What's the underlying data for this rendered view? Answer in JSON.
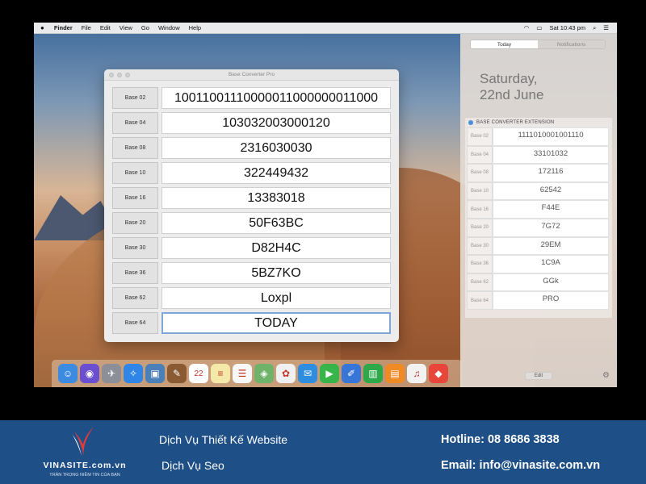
{
  "menubar": {
    "apple": "",
    "items": [
      "Finder",
      "File",
      "Edit",
      "View",
      "Go",
      "Window",
      "Help"
    ],
    "clock": "Sat 10:43 pm"
  },
  "app": {
    "title": "Base Converter Pro",
    "rows": [
      {
        "label": "Base 02",
        "value": "10011001110000011000000011000"
      },
      {
        "label": "Base 04",
        "value": "103032003000120"
      },
      {
        "label": "Base 08",
        "value": "2316030030"
      },
      {
        "label": "Base 10",
        "value": "322449432"
      },
      {
        "label": "Base 16",
        "value": "13383018"
      },
      {
        "label": "Base 20",
        "value": "50F63BC"
      },
      {
        "label": "Base 30",
        "value": "D82H4C"
      },
      {
        "label": "Base 36",
        "value": "5BZ7KO"
      },
      {
        "label": "Base 62",
        "value": "Loxpl"
      },
      {
        "label": "Base 64",
        "value": "TODAY"
      }
    ]
  },
  "notification_center": {
    "tabs": [
      "Today",
      "Notifications"
    ],
    "date_line1": "Saturday,",
    "date_line2": "22nd June",
    "extension_title": "BASE CONVERTER EXTENSION",
    "rows": [
      {
        "label": "Base 02",
        "value": "1111010001001110"
      },
      {
        "label": "Base 04",
        "value": "33101032"
      },
      {
        "label": "Base 08",
        "value": "172116"
      },
      {
        "label": "Base 10",
        "value": "62542"
      },
      {
        "label": "Base 16",
        "value": "F44E"
      },
      {
        "label": "Base 20",
        "value": "7G72"
      },
      {
        "label": "Base 30",
        "value": "29EM"
      },
      {
        "label": "Base 36",
        "value": "1C9A"
      },
      {
        "label": "Base 62",
        "value": "GGk"
      },
      {
        "label": "Base 64",
        "value": "PRO"
      }
    ],
    "edit_label": "Edit"
  },
  "dock": {
    "icons": [
      {
        "name": "finder-icon",
        "color": "#3d8be0",
        "glyph": "☺"
      },
      {
        "name": "siri-icon",
        "color": "#6a4fd1",
        "glyph": "◉"
      },
      {
        "name": "launchpad-icon",
        "color": "#8c8f98",
        "glyph": "✈"
      },
      {
        "name": "safari-icon",
        "color": "#2f86e6",
        "glyph": "✧"
      },
      {
        "name": "photo-browser-icon",
        "color": "#4a7fb8",
        "glyph": "▣"
      },
      {
        "name": "notes-brown-icon",
        "color": "#8a5a33",
        "glyph": "✎"
      },
      {
        "name": "calendar-icon",
        "color": "#ffffff",
        "glyph": "22"
      },
      {
        "name": "notes-icon",
        "color": "#f4e9a8",
        "glyph": "≡"
      },
      {
        "name": "reminders-icon",
        "color": "#f7f7f7",
        "glyph": "☰"
      },
      {
        "name": "maps-icon",
        "color": "#6fb36a",
        "glyph": "◈"
      },
      {
        "name": "photos-icon",
        "color": "#f0f0f0",
        "glyph": "✿"
      },
      {
        "name": "messages-icon",
        "color": "#2f8de0",
        "glyph": "✉"
      },
      {
        "name": "facetime-icon",
        "color": "#38b54a",
        "glyph": "▶"
      },
      {
        "name": "keynote-icon",
        "color": "#3776d6",
        "glyph": "✐"
      },
      {
        "name": "numbers-icon",
        "color": "#2fa84a",
        "glyph": "▥"
      },
      {
        "name": "pages-icon",
        "color": "#f08a24",
        "glyph": "▤"
      },
      {
        "name": "music-icon",
        "color": "#f2f2f2",
        "glyph": "♫"
      },
      {
        "name": "app-store-icon",
        "color": "#e8463b",
        "glyph": "◆"
      }
    ]
  },
  "footer": {
    "brand": "VINASITE.com.vn",
    "slogan": "TRÂN TRỌNG NIỀM TIN CỦA BẠN",
    "service1": "Dịch Vụ Thiết Kế Website",
    "service2": "Dịch Vụ Seo",
    "hotline": "Hotline: 08 8686 3838",
    "email": "Email: info@vinasite.com.vn",
    "bg_color": "#1e4f87"
  }
}
